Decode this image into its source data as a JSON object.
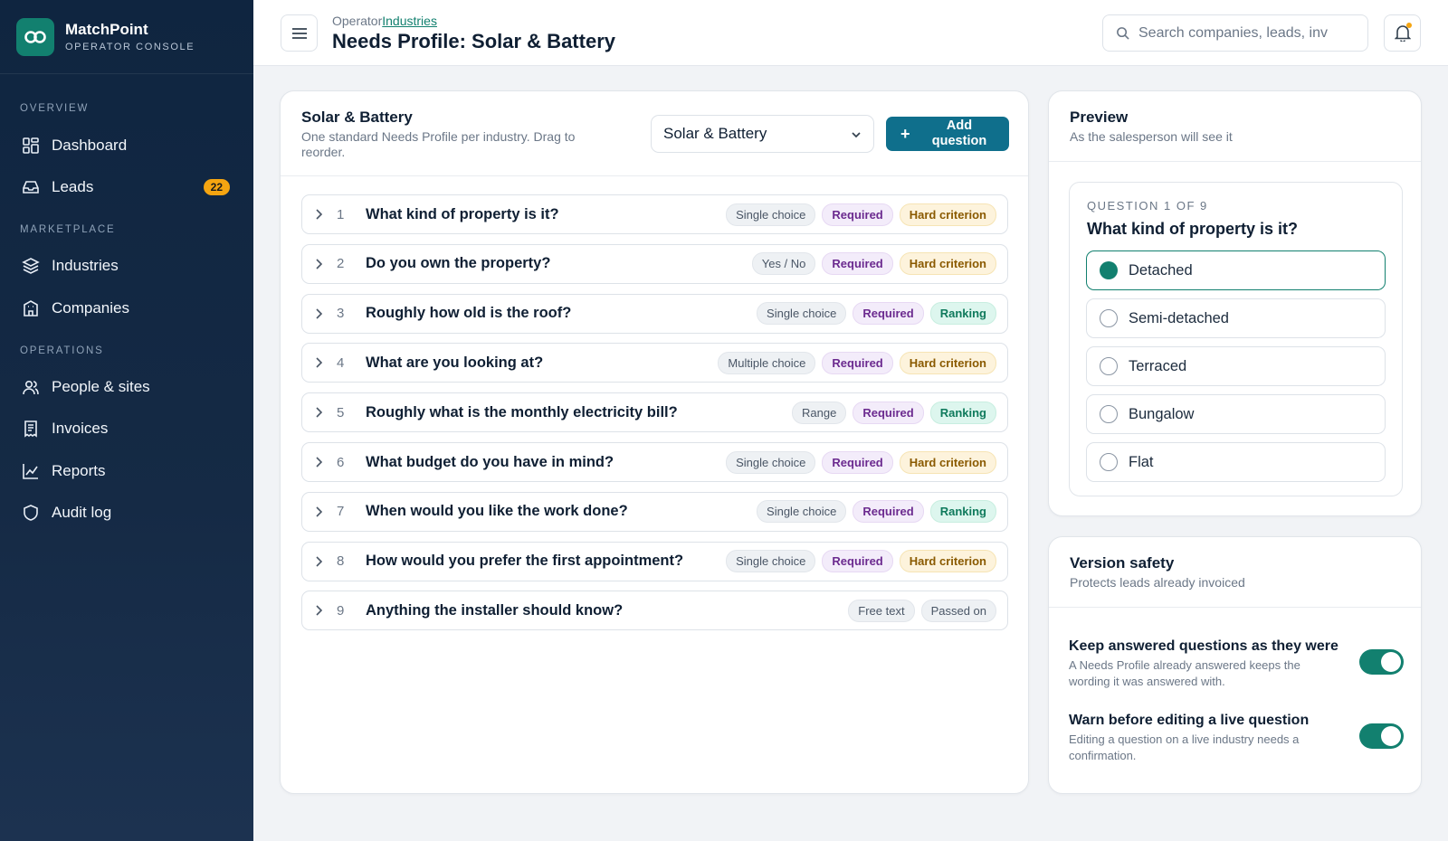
{
  "brand": {
    "name": "MatchPoint",
    "subtitle": "OPERATOR CONSOLE",
    "color": "#12806f"
  },
  "sidebar": {
    "sections": [
      {
        "label": "OVERVIEW"
      },
      {
        "label": "MARKETPLACE"
      },
      {
        "label": "OPERATIONS"
      }
    ],
    "items": [
      {
        "label": "Dashboard",
        "icon": "dashboard-icon"
      },
      {
        "label": "Leads",
        "icon": "inbox-icon",
        "badge": "22"
      },
      {
        "label": "Industries",
        "icon": "layers-icon"
      },
      {
        "label": "Companies",
        "icon": "building-icon"
      },
      {
        "label": "People & sites",
        "icon": "people-icon"
      },
      {
        "label": "Invoices",
        "icon": "invoice-icon"
      },
      {
        "label": "Reports",
        "icon": "chart-icon"
      },
      {
        "label": "Audit log",
        "icon": "shield-icon"
      }
    ]
  },
  "header": {
    "breadcrumb_root": "Operator",
    "breadcrumb_link": "Industries",
    "title": "Needs Profile: Solar & Battery",
    "search_placeholder": "Search companies, leads, inv"
  },
  "main": {
    "title": "Solar & Battery",
    "subtitle": "One standard Needs Profile per industry. Drag to reorder.",
    "industry_select_value": "Solar & Battery",
    "add_button_label": "Add question",
    "questions": [
      {
        "num": "1",
        "text": "What kind of property is it?",
        "type": "Single choice",
        "required": "Required",
        "criterion": "Hard criterion",
        "criterion_kind": "hard"
      },
      {
        "num": "2",
        "text": "Do you own the property?",
        "type": "Yes / No",
        "required": "Required",
        "criterion": "Hard criterion",
        "criterion_kind": "hard"
      },
      {
        "num": "3",
        "text": "Roughly how old is the roof?",
        "type": "Single choice",
        "required": "Required",
        "criterion": "Ranking",
        "criterion_kind": "rank"
      },
      {
        "num": "4",
        "text": "What are you looking at?",
        "type": "Multiple choice",
        "required": "Required",
        "criterion": "Hard criterion",
        "criterion_kind": "hard"
      },
      {
        "num": "5",
        "text": "Roughly what is the monthly electricity bill?",
        "type": "Range",
        "required": "Required",
        "criterion": "Ranking",
        "criterion_kind": "rank"
      },
      {
        "num": "6",
        "text": "What budget do you have in mind?",
        "type": "Single choice",
        "required": "Required",
        "criterion": "Hard criterion",
        "criterion_kind": "hard"
      },
      {
        "num": "7",
        "text": "When would you like the work done?",
        "type": "Single choice",
        "required": "Required",
        "criterion": "Ranking",
        "criterion_kind": "rank"
      },
      {
        "num": "8",
        "text": "How would you prefer the first appointment?",
        "type": "Single choice",
        "required": "Required",
        "criterion": "Hard criterion",
        "criterion_kind": "hard"
      },
      {
        "num": "9",
        "text": "Anything the installer should know?",
        "type": "Free text",
        "required": "",
        "criterion": "Passed on",
        "criterion_kind": "pass"
      }
    ]
  },
  "preview": {
    "title": "Preview",
    "subtitle": "As the salesperson will see it",
    "counter": "QUESTION 1 OF 9",
    "question": "What kind of property is it?",
    "options": [
      {
        "label": "Detached",
        "selected": true
      },
      {
        "label": "Semi-detached",
        "selected": false
      },
      {
        "label": "Terraced",
        "selected": false
      },
      {
        "label": "Bungalow",
        "selected": false
      },
      {
        "label": "Flat",
        "selected": false
      }
    ]
  },
  "version": {
    "title": "Version safety",
    "subtitle": "Protects leads already invoiced",
    "settings": [
      {
        "title": "Keep answered questions as they were",
        "desc": "A Needs Profile already answered keeps the wording it was answered with.",
        "enabled": true
      },
      {
        "title": "Warn before editing a live question",
        "desc": "Editing a question on a live industry needs a confirmation.",
        "enabled": true
      }
    ]
  }
}
